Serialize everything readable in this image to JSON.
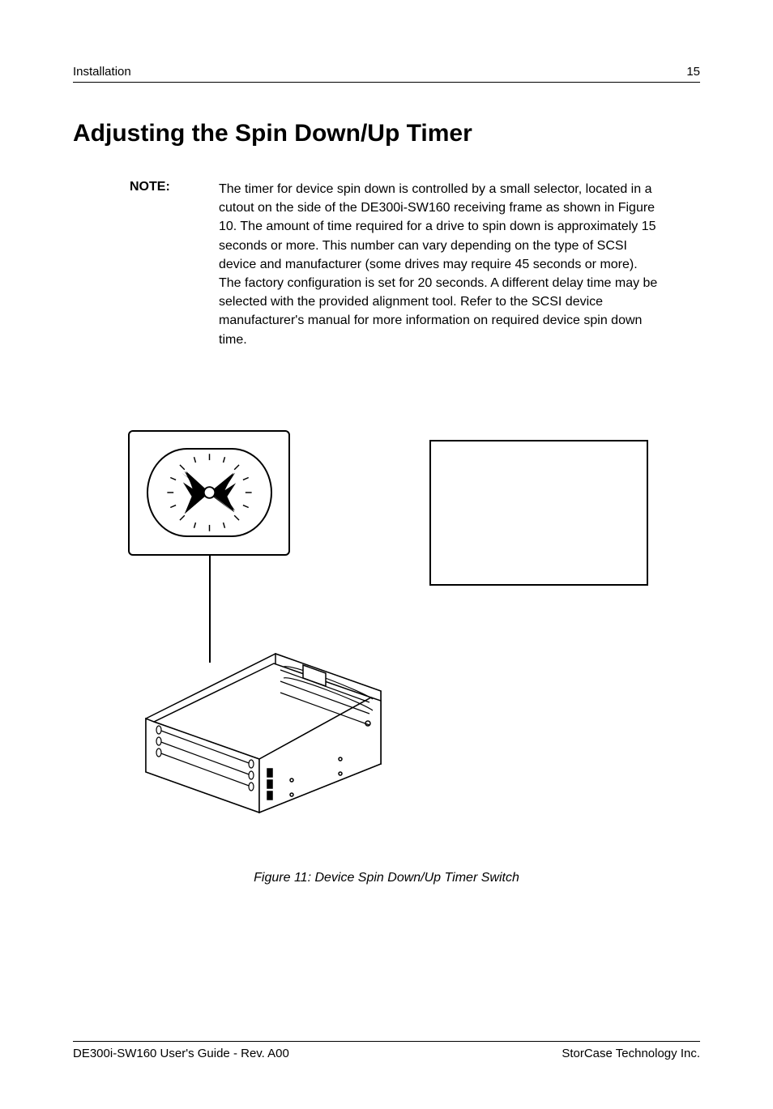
{
  "header": {
    "section": "Installation",
    "page": "15"
  },
  "title": "Adjusting the Spin Down/Up Timer",
  "note": {
    "label": "NOTE:",
    "text": "The timer for device spin down is controlled by a small selector, located in a cutout on the side of the DE300i-SW160 receiving frame as shown in Figure 10. The amount of time required for a drive to spin down is approximately 15 seconds or more.  This number can vary depending on the type of SCSI device and manufacturer (some drives may require 45 seconds or more).  The factory configuration is set for 20 seconds.  A different delay time may be selected with the provided alignment tool.  Refer to the SCSI device manufacturer's manual for more information on required device spin down time."
  },
  "figure_caption": "Figure 11:  Device Spin Down/Up Timer Switch",
  "footer": {
    "left": "DE300i-SW160 User's Guide - Rev. A00",
    "right": "StorCase Technology Inc."
  }
}
